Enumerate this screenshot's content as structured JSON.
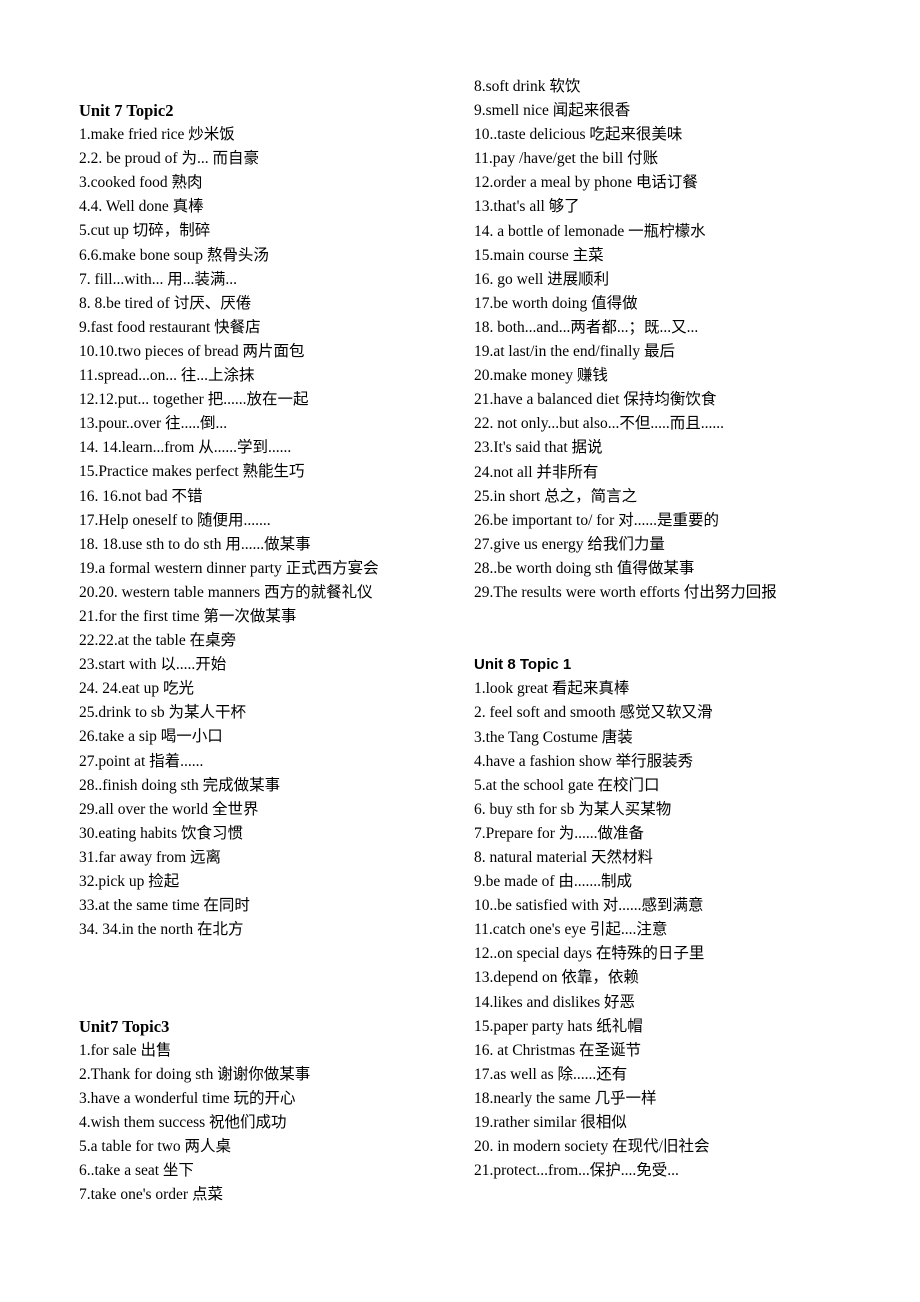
{
  "sections": {
    "u7t2": {
      "title": "Unit 7 Topic2",
      "items": [
        "1.make fried rice  炒米饭",
        "2.2. be proud of  为...  而自豪",
        "3.cooked food  熟肉",
        "4.4. Well done  真棒",
        "5.cut up  切碎，制碎",
        "6.6.make bone soup  熬骨头汤",
        "7. fill...with...  用...装满...",
        "8.    8.be tired of  讨厌、厌倦",
        "9.fast food restaurant  快餐店",
        "10.10.two pieces of bread  两片面包",
        "11.spread...on...  往...上涂抹",
        "12.12.put... together 把......放在一起",
        "13.pour..over  往.....倒...",
        "14. 14.learn...from 从......学到......",
        "15.Practice makes perfect  熟能生巧",
        "16. 16.not bad  不错",
        "17.Help oneself to  随便用.......",
        "18. 18.use sth to do sth  用......做某事",
        "19.a formal western dinner party 正式西方宴会",
        "20.20. western table manners 西方的就餐礼仪",
        "21.for the first time  第一次做某事",
        "22.22.at the table  在桌旁",
        "23.start with  以.....开始",
        "24. 24.eat up  吃光",
        "25.drink to sb  为某人干杯",
        "26.take a sip  喝一小口",
        "27.point at  指着......",
        "28..finish doing sth  完成做某事",
        "29.all over the world  全世界",
        "30.eating habits  饮食习惯",
        "31.far away from  远离",
        "32.pick up  捡起",
        "33.at the same time  在同时",
        "34. 34.in the north  在北方"
      ]
    },
    "u7t3": {
      "title": "Unit7 Topic3",
      "items": [
        "1.for sale  出售",
        "2.Thank for doing sth  谢谢你做某事",
        "3.have a wonderful time  玩的开心",
        "4.wish them success  祝他们成功",
        "5.a table for two  两人桌",
        "6..take a seat  坐下",
        "7.take one's order  点菜",
        "8.soft drink  软饮",
        "9.smell nice  闻起来很香",
        "10..taste delicious  吃起来很美味",
        "11.pay /have/get the bill  付账",
        "12.order a meal by phone  电话订餐",
        "13.that's all  够了",
        "14. a bottle of lemonade  一瓶柠檬水",
        "15.main course  主菜",
        "16. go well  进展顺利",
        "17.be worth doing  值得做",
        "18. both...and...两者都...；既...又...",
        "19.at last/in the end/finally 最后",
        "20.make money  赚钱",
        "21.have a balanced diet  保持均衡饮食",
        "22. not only...but also...不但.....而且......",
        "23.It's said that  据说",
        "24.not all  并非所有",
        "25.in short  总之，简言之",
        "26.be important to/ for  对......是重要的",
        "27.give us energy  给我们力量",
        "28..be worth doing sth  值得做某事",
        "29.The results were worth efforts  付出努力回报"
      ]
    },
    "u8t1": {
      "title": "Unit 8 Topic 1",
      "items": [
        "1.look great  看起来真棒",
        "2. feel soft and smooth  感觉又软又滑",
        "3.the Tang Costume  唐装",
        "4.have a fashion show  举行服装秀",
        "5.at the school gate  在校门口",
        "6. buy sth for sb  为某人买某物",
        "7.Prepare for  为......做准备",
        "8. natural material  天然材料",
        "9.be made of  由.......制成",
        "10..be satisfied with  对......感到满意",
        "11.catch one's eye  引起....注意",
        "12..on special days  在特殊的日子里",
        "13.depend on  依靠，依赖",
        "14.likes and dislikes  好恶",
        "15.paper party hats  纸礼帽",
        "16. at Christmas  在圣诞节",
        "17.as well as  除......还有",
        "18.nearly the same 几乎一样",
        "19.rather similar  很相似",
        "20. in modern society  在现代/旧社会",
        "21.protect...from...保护....免受..."
      ]
    }
  }
}
